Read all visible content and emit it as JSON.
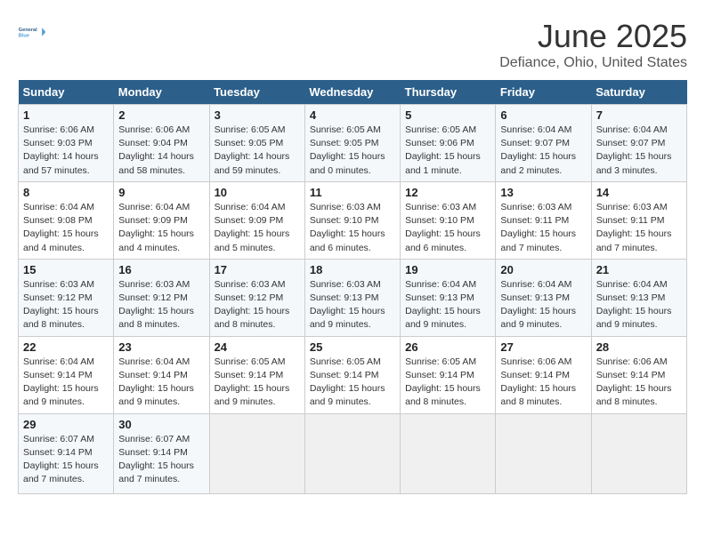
{
  "header": {
    "logo_line1": "General",
    "logo_line2": "Blue",
    "title": "June 2025",
    "subtitle": "Defiance, Ohio, United States"
  },
  "calendar": {
    "days_of_week": [
      "Sunday",
      "Monday",
      "Tuesday",
      "Wednesday",
      "Thursday",
      "Friday",
      "Saturday"
    ],
    "weeks": [
      [
        {
          "day": 1,
          "info": "Sunrise: 6:06 AM\nSunset: 9:03 PM\nDaylight: 14 hours and 57 minutes."
        },
        {
          "day": 2,
          "info": "Sunrise: 6:06 AM\nSunset: 9:04 PM\nDaylight: 14 hours and 58 minutes."
        },
        {
          "day": 3,
          "info": "Sunrise: 6:05 AM\nSunset: 9:05 PM\nDaylight: 14 hours and 59 minutes."
        },
        {
          "day": 4,
          "info": "Sunrise: 6:05 AM\nSunset: 9:05 PM\nDaylight: 15 hours and 0 minutes."
        },
        {
          "day": 5,
          "info": "Sunrise: 6:05 AM\nSunset: 9:06 PM\nDaylight: 15 hours and 1 minute."
        },
        {
          "day": 6,
          "info": "Sunrise: 6:04 AM\nSunset: 9:07 PM\nDaylight: 15 hours and 2 minutes."
        },
        {
          "day": 7,
          "info": "Sunrise: 6:04 AM\nSunset: 9:07 PM\nDaylight: 15 hours and 3 minutes."
        }
      ],
      [
        {
          "day": 8,
          "info": "Sunrise: 6:04 AM\nSunset: 9:08 PM\nDaylight: 15 hours and 4 minutes."
        },
        {
          "day": 9,
          "info": "Sunrise: 6:04 AM\nSunset: 9:09 PM\nDaylight: 15 hours and 4 minutes."
        },
        {
          "day": 10,
          "info": "Sunrise: 6:04 AM\nSunset: 9:09 PM\nDaylight: 15 hours and 5 minutes."
        },
        {
          "day": 11,
          "info": "Sunrise: 6:03 AM\nSunset: 9:10 PM\nDaylight: 15 hours and 6 minutes."
        },
        {
          "day": 12,
          "info": "Sunrise: 6:03 AM\nSunset: 9:10 PM\nDaylight: 15 hours and 6 minutes."
        },
        {
          "day": 13,
          "info": "Sunrise: 6:03 AM\nSunset: 9:11 PM\nDaylight: 15 hours and 7 minutes."
        },
        {
          "day": 14,
          "info": "Sunrise: 6:03 AM\nSunset: 9:11 PM\nDaylight: 15 hours and 7 minutes."
        }
      ],
      [
        {
          "day": 15,
          "info": "Sunrise: 6:03 AM\nSunset: 9:12 PM\nDaylight: 15 hours and 8 minutes."
        },
        {
          "day": 16,
          "info": "Sunrise: 6:03 AM\nSunset: 9:12 PM\nDaylight: 15 hours and 8 minutes."
        },
        {
          "day": 17,
          "info": "Sunrise: 6:03 AM\nSunset: 9:12 PM\nDaylight: 15 hours and 8 minutes."
        },
        {
          "day": 18,
          "info": "Sunrise: 6:03 AM\nSunset: 9:13 PM\nDaylight: 15 hours and 9 minutes."
        },
        {
          "day": 19,
          "info": "Sunrise: 6:04 AM\nSunset: 9:13 PM\nDaylight: 15 hours and 9 minutes."
        },
        {
          "day": 20,
          "info": "Sunrise: 6:04 AM\nSunset: 9:13 PM\nDaylight: 15 hours and 9 minutes."
        },
        {
          "day": 21,
          "info": "Sunrise: 6:04 AM\nSunset: 9:13 PM\nDaylight: 15 hours and 9 minutes."
        }
      ],
      [
        {
          "day": 22,
          "info": "Sunrise: 6:04 AM\nSunset: 9:14 PM\nDaylight: 15 hours and 9 minutes."
        },
        {
          "day": 23,
          "info": "Sunrise: 6:04 AM\nSunset: 9:14 PM\nDaylight: 15 hours and 9 minutes."
        },
        {
          "day": 24,
          "info": "Sunrise: 6:05 AM\nSunset: 9:14 PM\nDaylight: 15 hours and 9 minutes."
        },
        {
          "day": 25,
          "info": "Sunrise: 6:05 AM\nSunset: 9:14 PM\nDaylight: 15 hours and 9 minutes."
        },
        {
          "day": 26,
          "info": "Sunrise: 6:05 AM\nSunset: 9:14 PM\nDaylight: 15 hours and 8 minutes."
        },
        {
          "day": 27,
          "info": "Sunrise: 6:06 AM\nSunset: 9:14 PM\nDaylight: 15 hours and 8 minutes."
        },
        {
          "day": 28,
          "info": "Sunrise: 6:06 AM\nSunset: 9:14 PM\nDaylight: 15 hours and 8 minutes."
        }
      ],
      [
        {
          "day": 29,
          "info": "Sunrise: 6:07 AM\nSunset: 9:14 PM\nDaylight: 15 hours and 7 minutes."
        },
        {
          "day": 30,
          "info": "Sunrise: 6:07 AM\nSunset: 9:14 PM\nDaylight: 15 hours and 7 minutes."
        },
        null,
        null,
        null,
        null,
        null
      ]
    ]
  }
}
